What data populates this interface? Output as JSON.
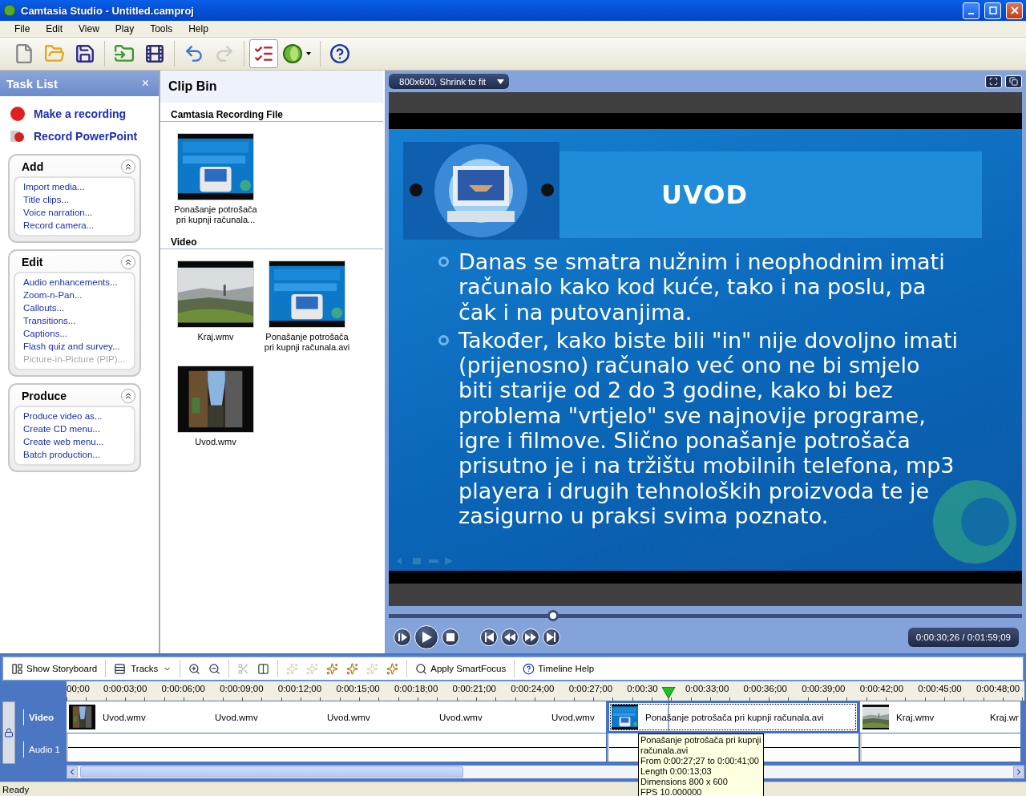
{
  "window": {
    "title": "Camtasia Studio - Untitled.camproj"
  },
  "menu": [
    "File",
    "Edit",
    "View",
    "Play",
    "Tools",
    "Help"
  ],
  "toolbar": [
    [
      {
        "kind": "new",
        "disabled": false,
        "pressed": false
      },
      {
        "kind": "open",
        "disabled": false,
        "pressed": false
      },
      {
        "kind": "save",
        "disabled": false,
        "pressed": false
      }
    ],
    [
      {
        "kind": "import",
        "disabled": false,
        "pressed": false
      },
      {
        "kind": "produce",
        "disabled": false,
        "pressed": false
      }
    ],
    [
      {
        "kind": "undo",
        "disabled": false,
        "pressed": false
      },
      {
        "kind": "redo",
        "disabled": true,
        "pressed": false
      }
    ],
    [
      {
        "kind": "tasks",
        "disabled": false,
        "pressed": true
      },
      {
        "kind": "logo",
        "disabled": false,
        "pressed": false
      }
    ],
    [
      {
        "kind": "help",
        "disabled": false,
        "pressed": false
      }
    ]
  ],
  "task_list": {
    "title": "Task List",
    "close": "×",
    "actions": [
      {
        "kind": "record",
        "label": "Make a recording"
      },
      {
        "kind": "powerpoint",
        "label": "Record PowerPoint"
      }
    ],
    "groups": [
      {
        "title": "Add",
        "expanded": true,
        "items": [
          {
            "label": "Import media...",
            "disabled": false
          },
          {
            "label": "Title clips...",
            "disabled": false
          },
          {
            "label": "Voice narration...",
            "disabled": false
          },
          {
            "label": "Record camera...",
            "disabled": false
          }
        ]
      },
      {
        "title": "Edit",
        "expanded": true,
        "items": [
          {
            "label": "Audio enhancements...",
            "disabled": false
          },
          {
            "label": "Zoom-n-Pan...",
            "disabled": false
          },
          {
            "label": "Callouts...",
            "disabled": false
          },
          {
            "label": "Transitions...",
            "disabled": false
          },
          {
            "label": "Captions...",
            "disabled": false
          },
          {
            "label": "Flash quiz and survey...",
            "disabled": false
          },
          {
            "label": "Picture-in-Picture (PIP)...",
            "disabled": true
          }
        ]
      },
      {
        "title": "Produce",
        "expanded": true,
        "items": [
          {
            "label": "Produce video as...",
            "disabled": false
          },
          {
            "label": "Create CD menu...",
            "disabled": false
          },
          {
            "label": "Create web menu...",
            "disabled": false
          },
          {
            "label": "Batch production...",
            "disabled": false
          }
        ]
      }
    ]
  },
  "clip_bin": {
    "title": "Clip Bin",
    "sections": [
      {
        "title": "Camtasia Recording File",
        "clips": [
          {
            "caption": "Ponašanje potrošača pri kupnji računala..."
          }
        ]
      },
      {
        "title": "Video",
        "clips": [
          {
            "caption": "Kraj.wmv"
          },
          {
            "caption": "Ponašanje potrošača pri kupnji računala.avi"
          },
          {
            "caption": "Uvod.wmv"
          }
        ]
      }
    ]
  },
  "preview": {
    "zoom_mode": "800x600, Shrink to fit",
    "slide": {
      "title": "UVOD",
      "bullets": [
        "Danas se smatra nužnim i neophodnim imati računalo kako kod kuće, tako i na poslu, pa čak i na putovanjima.",
        "Također, kako biste bili \"in\" nije dovoljno imati (prijenosno) računalo već ono ne bi smjelo biti starije od 2 do 3 godine, kako bi bez problema \"vrtjelo\" sve najnovije programe, igre i filmove. Slično ponašanje potrošača prisutno je i na tržištu mobilnih telefona, mp3 playera i drugih tehnoloških proizvoda te je zasigurno u praksi svima poznato."
      ]
    },
    "scrubber": {
      "level": 0.26
    },
    "time": "0:00:30;26 / 0:01:59;09"
  },
  "timeline": {
    "toolbar": [
      {
        "kind": "storyboard",
        "label": "Show Storyboard",
        "disabled": false
      },
      {
        "kind": "tracks",
        "label": "Tracks",
        "disabled": false
      },
      {
        "kind": "zoom-in",
        "disabled": false
      },
      {
        "kind": "zoom-out",
        "disabled": false
      },
      {
        "kind": "cut",
        "disabled": true
      },
      {
        "kind": "split",
        "disabled": false
      },
      {
        "kind": "effect",
        "disabled": true
      },
      {
        "kind": "effect",
        "disabled": true
      },
      {
        "kind": "effect",
        "disabled": false
      },
      {
        "kind": "effect",
        "disabled": false
      },
      {
        "kind": "effect",
        "disabled": true
      },
      {
        "kind": "effect",
        "disabled": false
      },
      {
        "kind": "smartfocus",
        "label": "Apply SmartFocus",
        "disabled": false
      },
      {
        "kind": "help",
        "label": "Timeline Help",
        "disabled": false
      }
    ],
    "ruler": [
      "00;00",
      "0:00:03;00",
      "0:00:06;00",
      "0:00:09;00",
      "0:00:12;00",
      "0:00:15;00",
      "0:00:18;00",
      "0:00:21;00",
      "0:00:24;00",
      "0:00:27;00",
      "0:00:30",
      "0:00:33;00",
      "0:00:36;00",
      "0:00:39;00",
      "0:00:42;00",
      "0:00:45;00",
      "0:00:48;00"
    ],
    "tracks": [
      {
        "name": "Video"
      },
      {
        "name": "Audio 1"
      }
    ],
    "clips": [
      {
        "labels": [
          "Uvod.wmv",
          "Uvod.wmv",
          "Uvod.wmv",
          "Uvod.wmv",
          "Uvod.wmv"
        ],
        "selected": false
      },
      {
        "labels": [
          "Ponašanje potrošača pri kupnji računala.avi"
        ],
        "selected": true
      },
      {
        "labels": [
          "Kraj.wmv",
          "Kraj.wr"
        ],
        "selected": false
      }
    ],
    "tooltip": [
      "Ponašanje potrošača pri kupnji",
      "računala.avi",
      "From 0:00:27;27 to 0:00:41;00",
      "Length 0:00:13;03",
      "Dimensions 800 x 600",
      "FPS 10.000000"
    ]
  },
  "status_bar": "Ready"
}
